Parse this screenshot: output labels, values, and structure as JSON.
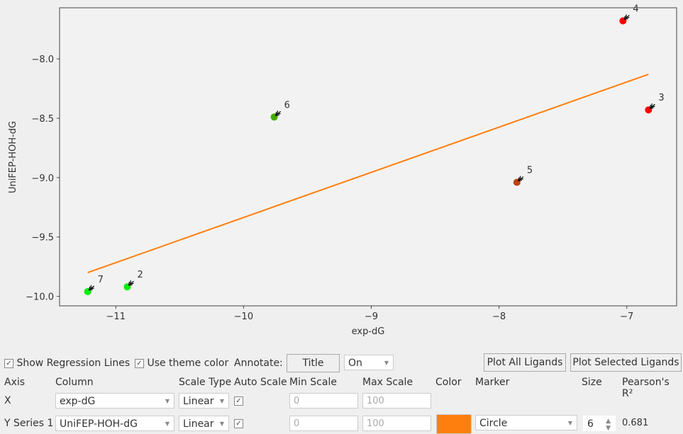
{
  "chart_data": {
    "type": "scatter",
    "xlabel": "exp-dG",
    "ylabel": "UniFEP-HOH-dG",
    "xlim": [
      -11.44,
      -6.61
    ],
    "ylim": [
      -10.08,
      -7.57
    ],
    "xticks": [
      -11,
      -10,
      -9,
      -8,
      -7
    ],
    "yticks": [
      -8.0,
      -8.5,
      -9.0,
      -9.5,
      -10.0
    ],
    "xtick_labels": [
      "−11",
      "−10",
      "−9",
      "−8",
      "−7"
    ],
    "ytick_labels": [
      "−8.0",
      "−8.5",
      "−9.0",
      "−9.5",
      "−10.0"
    ],
    "grid": false,
    "points": [
      {
        "label": "7",
        "x": -11.22,
        "y": -9.96,
        "color": "#00ee00"
      },
      {
        "label": "2",
        "x": -10.91,
        "y": -9.92,
        "color": "#00ee00"
      },
      {
        "label": "6",
        "x": -9.76,
        "y": -8.49,
        "color": "#44aa00"
      },
      {
        "label": "5",
        "x": -7.86,
        "y": -9.04,
        "color": "#c04010"
      },
      {
        "label": "4",
        "x": -7.03,
        "y": -7.68,
        "color": "#ff0000"
      },
      {
        "label": "3",
        "x": -6.83,
        "y": -8.43,
        "color": "#ff0000"
      }
    ],
    "regression_line": {
      "x": [
        -11.22,
        -6.83
      ],
      "y": [
        -9.8,
        -8.13
      ],
      "color": "#ff7f0e"
    }
  },
  "controls": {
    "show_regression": {
      "label": "Show Regression Lines",
      "checked": true
    },
    "use_theme_color": {
      "label": "Use theme color",
      "checked": true
    },
    "annotate_label": "Annotate:",
    "title_button": "Title",
    "annotate_value": "On",
    "plot_all": "Plot All Ligands",
    "plot_selected": "Plot Selected Ligands"
  },
  "table": {
    "headers": [
      "Axis",
      "Column",
      "Scale Type",
      "Auto Scale",
      "Min Scale",
      "Max Scale",
      "Color",
      "Marker",
      "Size",
      "Pearson's R²"
    ],
    "x_row": {
      "axis": "X",
      "column": "exp-dG",
      "scale": "Linear",
      "auto": true,
      "min": "0",
      "max": "100"
    },
    "y_row": {
      "axis": "Y Series 1",
      "column": "UniFEP-HOH-dG",
      "scale": "Linear",
      "auto": true,
      "min": "0",
      "max": "100",
      "color": "#ff7f0e",
      "marker": "Circle",
      "size": "6",
      "pearson": "0.681"
    }
  }
}
